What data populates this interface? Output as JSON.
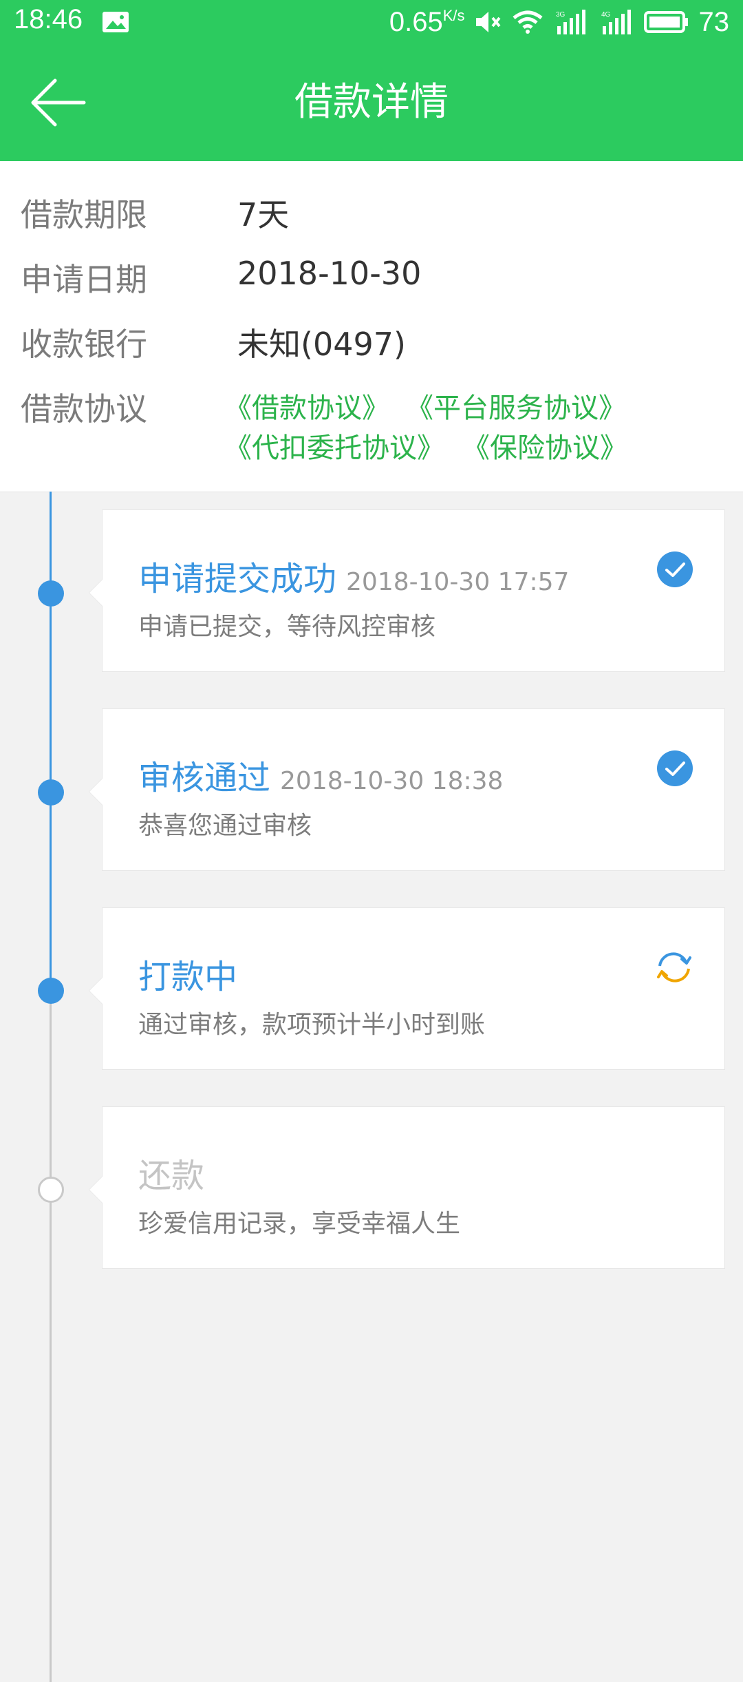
{
  "status_bar": {
    "time": "18:46",
    "speed": "0.65",
    "speed_unit": "K/s",
    "net_3g": "3G",
    "net_4g": "4G",
    "battery": "73"
  },
  "app_bar": {
    "title": "借款详情",
    "back_icon": "arrow-left-icon"
  },
  "info": {
    "rows": [
      {
        "label": "借款期限",
        "value": "7天"
      },
      {
        "label": "申请日期",
        "value": "2018-10-30"
      },
      {
        "label": "收款银行",
        "value": "未知(0497)"
      },
      {
        "label": "借款协议"
      }
    ],
    "agreements": [
      "《借款协议》",
      "《平台服务协议》",
      "《代扣委托协议》",
      "《保险协议》"
    ]
  },
  "timeline": [
    {
      "title": "申请提交成功",
      "time": "2018-10-30 17:57",
      "desc": "申请已提交，等待风控审核",
      "status": "done",
      "icon": "check-icon"
    },
    {
      "title": "审核通过",
      "time": "2018-10-30 18:38",
      "desc": "恭喜您通过审核",
      "status": "done",
      "icon": "check-icon"
    },
    {
      "title": "打款中",
      "desc": "通过审核，款项预计半小时到账",
      "status": "in-progress",
      "icon": "refresh-icon"
    },
    {
      "title": "还款",
      "desc": "珍爱信用记录，享受幸福人生",
      "status": "pending"
    }
  ],
  "colors": {
    "brand_green": "#2ccb5f",
    "link_green": "#2cb34b",
    "timeline_blue": "#3a95e0",
    "pending_gray": "#c4c4c4",
    "progress_orange": "#f0a500"
  }
}
